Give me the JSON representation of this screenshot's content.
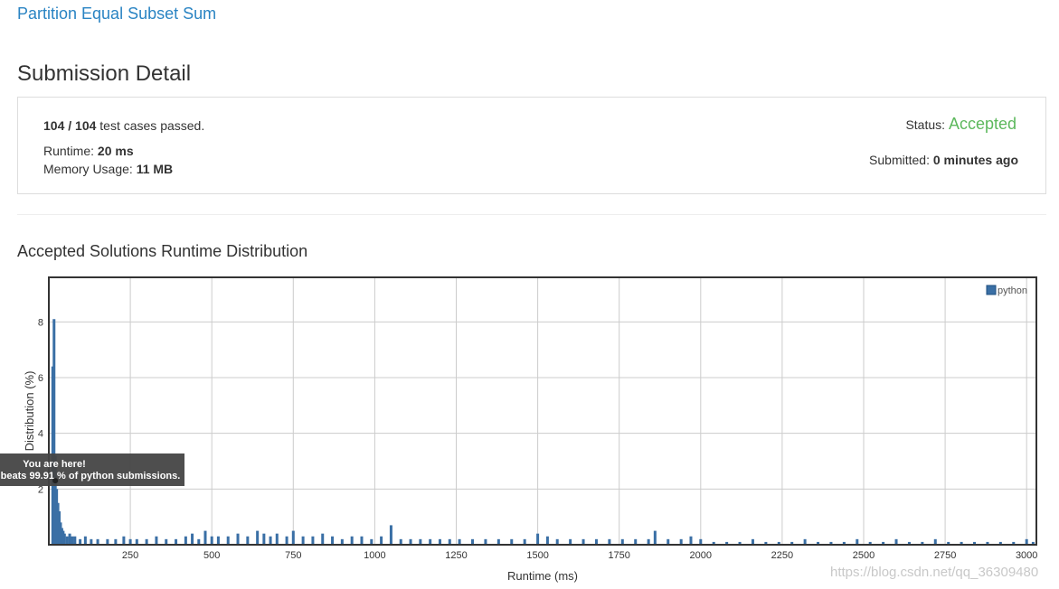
{
  "problem": {
    "title": "Partition Equal Subset Sum"
  },
  "page": {
    "title": "Submission Detail"
  },
  "detail": {
    "passed": "104",
    "separator": "/",
    "total": "104",
    "cases_text": "test cases passed.",
    "runtime_label": "Runtime:",
    "runtime_value": "20 ms",
    "memory_label": "Memory Usage:",
    "memory_value": "11 MB",
    "status_label": "Status:",
    "status_value": "Accepted",
    "submitted_label": "Submitted:",
    "submitted_value": "0 minutes ago"
  },
  "distribution": {
    "title": "Accepted Solutions Runtime Distribution"
  },
  "tooltip": {
    "line1": "You are here!",
    "line2": "beats 99.91 % of python submissions."
  },
  "watermark": "https://blog.csdn.net/qq_36309480",
  "colors": {
    "link": "#2a84c3",
    "accepted": "#5cb85c",
    "bar": "#3a6fa5",
    "grid": "#cccccc",
    "tooltip": "#444444"
  },
  "chart_data": {
    "type": "bar",
    "xlabel": "Runtime (ms)",
    "ylabel": "Distribution (%)",
    "xlim": [
      0,
      3030
    ],
    "ylim": [
      0,
      9.6
    ],
    "xticks": [
      250,
      500,
      750,
      1000,
      1250,
      1500,
      1750,
      2000,
      2250,
      2500,
      2750,
      3000
    ],
    "yticks": [
      2,
      4,
      6,
      8
    ],
    "grid": true,
    "legend": "top-right",
    "series": [
      {
        "name": "python",
        "x": [
          12,
          16,
          20,
          24,
          28,
          32,
          36,
          40,
          44,
          48,
          56,
          64,
          72,
          80,
          96,
          112,
          130,
          150,
          180,
          205,
          230,
          250,
          270,
          300,
          330,
          360,
          390,
          420,
          440,
          460,
          480,
          500,
          520,
          550,
          580,
          610,
          640,
          660,
          680,
          700,
          730,
          750,
          780,
          810,
          840,
          870,
          900,
          930,
          960,
          990,
          1020,
          1050,
          1080,
          1110,
          1140,
          1170,
          1200,
          1230,
          1260,
          1300,
          1340,
          1380,
          1420,
          1460,
          1500,
          1530,
          1560,
          1600,
          1640,
          1680,
          1720,
          1760,
          1800,
          1840,
          1860,
          1900,
          1940,
          1970,
          2000,
          2040,
          2080,
          2120,
          2160,
          2200,
          2240,
          2280,
          2320,
          2360,
          2400,
          2440,
          2480,
          2520,
          2560,
          2600,
          2640,
          2680,
          2720,
          2760,
          2800,
          2840,
          2880,
          2920,
          2960,
          3000,
          3020
        ],
        "values": [
          6.4,
          8.1,
          3.2,
          2.0,
          1.5,
          1.2,
          0.8,
          0.6,
          0.5,
          0.4,
          0.3,
          0.4,
          0.3,
          0.3,
          0.2,
          0.3,
          0.2,
          0.2,
          0.2,
          0.2,
          0.3,
          0.2,
          0.2,
          0.2,
          0.3,
          0.2,
          0.2,
          0.3,
          0.4,
          0.2,
          0.5,
          0.3,
          0.3,
          0.3,
          0.4,
          0.3,
          0.5,
          0.4,
          0.3,
          0.4,
          0.3,
          0.5,
          0.3,
          0.3,
          0.4,
          0.3,
          0.2,
          0.3,
          0.3,
          0.2,
          0.3,
          0.7,
          0.2,
          0.2,
          0.2,
          0.2,
          0.2,
          0.2,
          0.2,
          0.2,
          0.2,
          0.2,
          0.2,
          0.2,
          0.4,
          0.3,
          0.2,
          0.2,
          0.2,
          0.2,
          0.2,
          0.2,
          0.2,
          0.2,
          0.5,
          0.2,
          0.2,
          0.3,
          0.2,
          0.1,
          0.1,
          0.1,
          0.2,
          0.1,
          0.1,
          0.1,
          0.2,
          0.1,
          0.1,
          0.1,
          0.2,
          0.1,
          0.1,
          0.2,
          0.1,
          0.1,
          0.2,
          0.1,
          0.1,
          0.1,
          0.1,
          0.1,
          0.1,
          0.2,
          0.1
        ]
      }
    ],
    "marker": {
      "x": 20,
      "y": 2.3
    }
  }
}
